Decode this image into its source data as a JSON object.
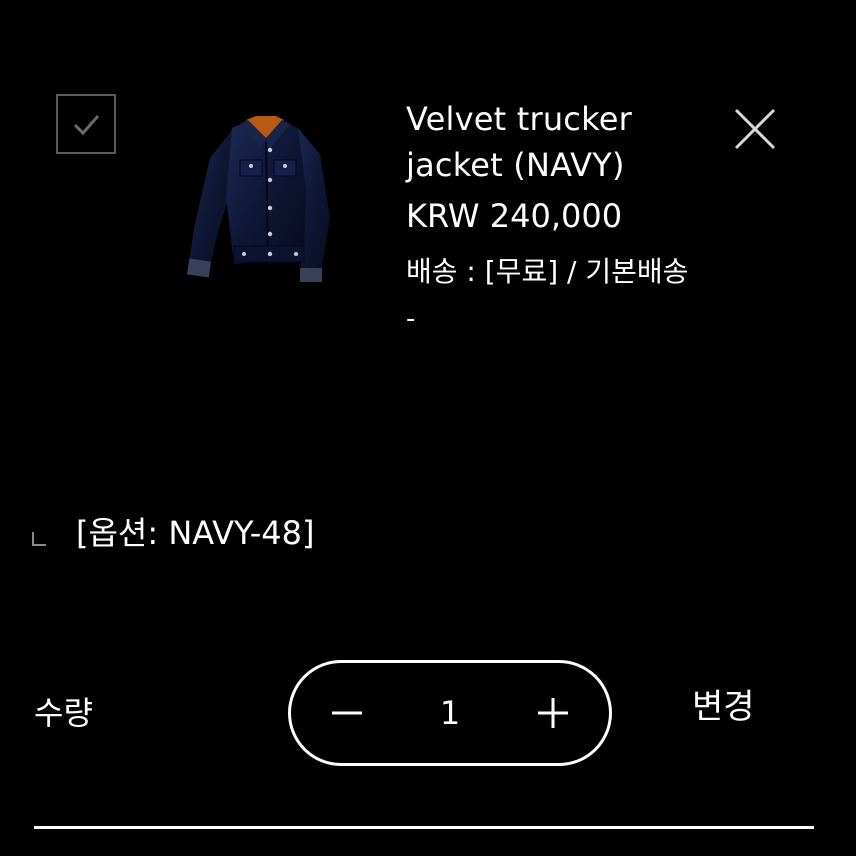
{
  "cart_item": {
    "checked": true,
    "product_image_icon": "velvet-trucker-jacket-image",
    "name_line1": "Velvet trucker",
    "name_line2": "jacket (NAVY)",
    "price": "KRW 240,000",
    "shipping": "배송 : [무료] / 기본배송",
    "extra": "-",
    "option": "[옵션: NAVY-48]",
    "quantity_label": "수량",
    "quantity": "1",
    "change_label": "변경"
  },
  "colors": {
    "background": "#000000",
    "text": "#ffffff",
    "checkbox_border": "#5a5a5a",
    "jacket_navy": "#141c3a"
  }
}
